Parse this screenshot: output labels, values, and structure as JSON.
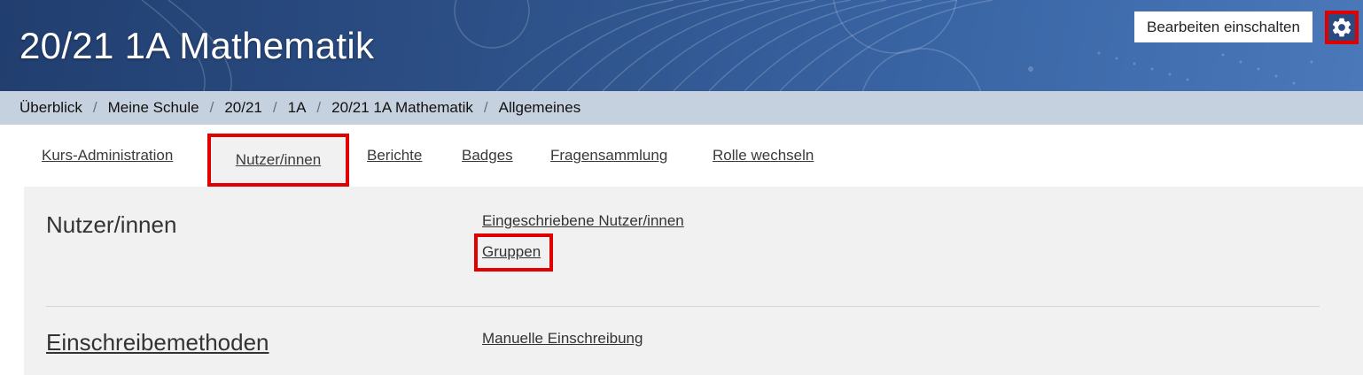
{
  "header": {
    "course_title": "20/21 1A Mathematik",
    "edit_button_label": "Bearbeiten einschalten",
    "settings_icon": "gear-icon"
  },
  "breadcrumb": {
    "items": [
      "Überblick",
      "Meine Schule",
      "20/21",
      "1A",
      "20/21 1A Mathematik",
      "Allgemeines"
    ],
    "separator": "/"
  },
  "tabs": {
    "items": [
      "Kurs-Administration",
      "Nutzer/innen",
      "Berichte",
      "Badges",
      "Fragensammlung",
      "Rolle wechseln"
    ],
    "active_index": 1
  },
  "sections": [
    {
      "title": "Nutzer/innen",
      "links": [
        "Eingeschriebene Nutzer/innen",
        "Gruppen"
      ]
    },
    {
      "title": "Einschreibemethoden",
      "links": [
        "Manuelle Einschreibung"
      ]
    }
  ],
  "colors": {
    "header_bg": "#2c4f86",
    "breadcrumb_bg": "#c6d1df",
    "panel_bg": "#f1f1f1",
    "highlight": "#e00000"
  }
}
